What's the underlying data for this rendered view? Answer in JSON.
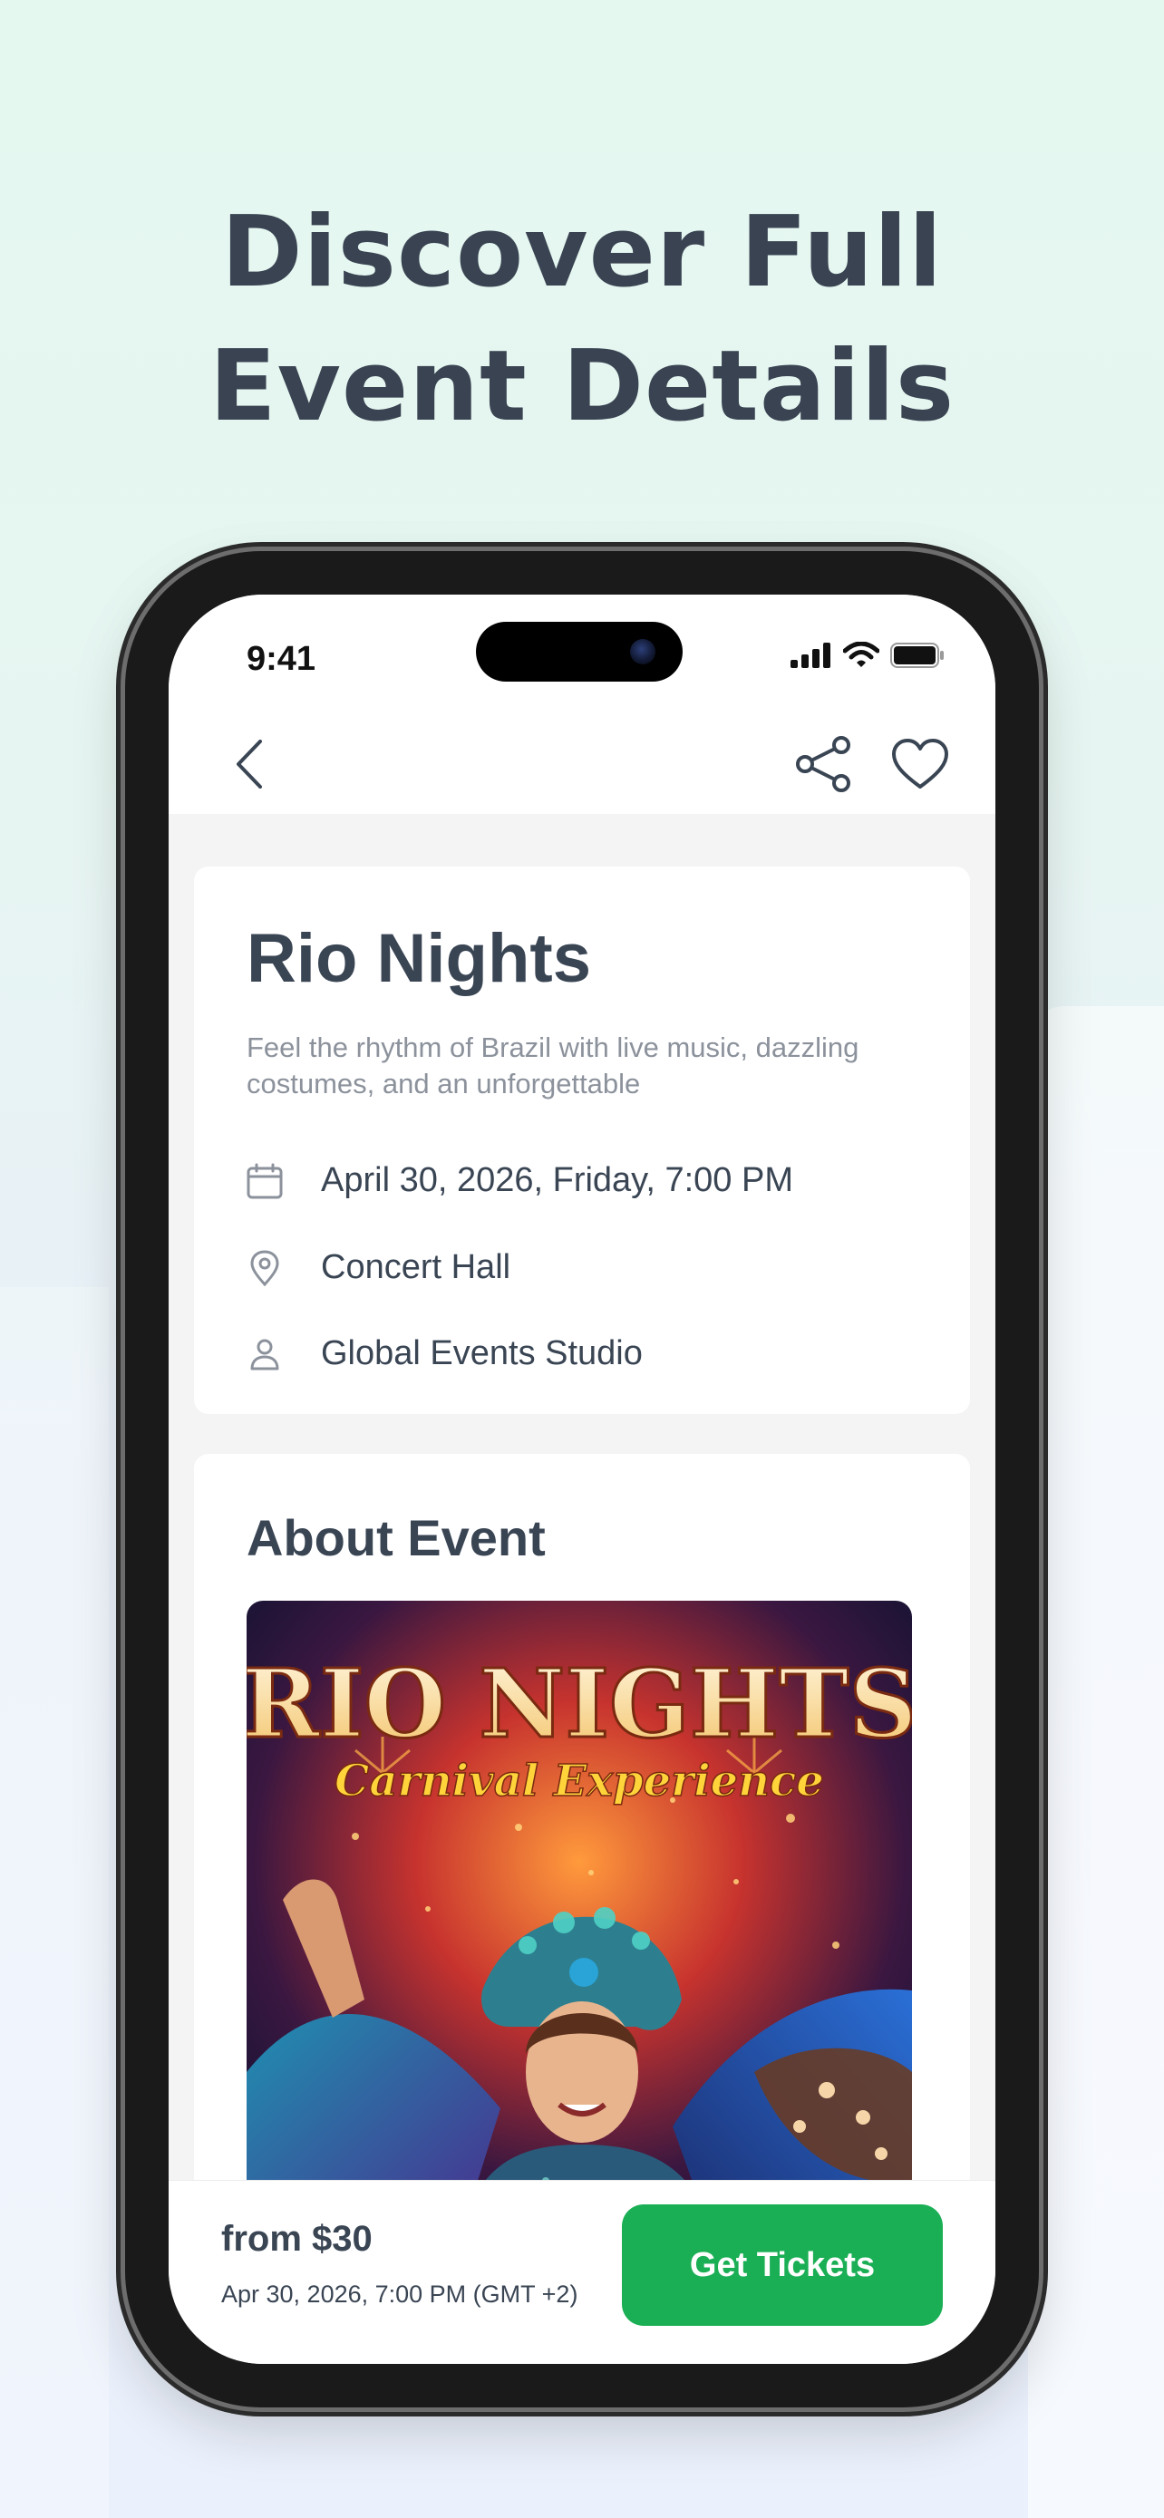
{
  "headline": {
    "line1": "Discover Full",
    "line2": "Event Details"
  },
  "status_bar": {
    "time": "9:41"
  },
  "nav": {
    "back_icon": "chevron-left-icon",
    "share_icon": "share-icon",
    "favorite_icon": "heart-icon"
  },
  "event": {
    "title": "Rio Nights",
    "description": "Feel the rhythm of Brazil with live music, dazzling costumes, and an unforgettable",
    "date": "April 30, 2026, Friday, 7:00 PM",
    "venue": "Concert Hall",
    "organizer": "Global Events Studio"
  },
  "about": {
    "title": "About Event",
    "poster": {
      "title": "RIO NIGHTS",
      "subtitle": "Carnival Experience"
    }
  },
  "purchase": {
    "price": "from $30",
    "date": "Apr 30, 2026, 7:00 PM (GMT +2)",
    "button_label": "Get Tickets"
  },
  "colors": {
    "accent": "#1aaf55",
    "text": "#3a4554",
    "muted": "#8c929c"
  }
}
